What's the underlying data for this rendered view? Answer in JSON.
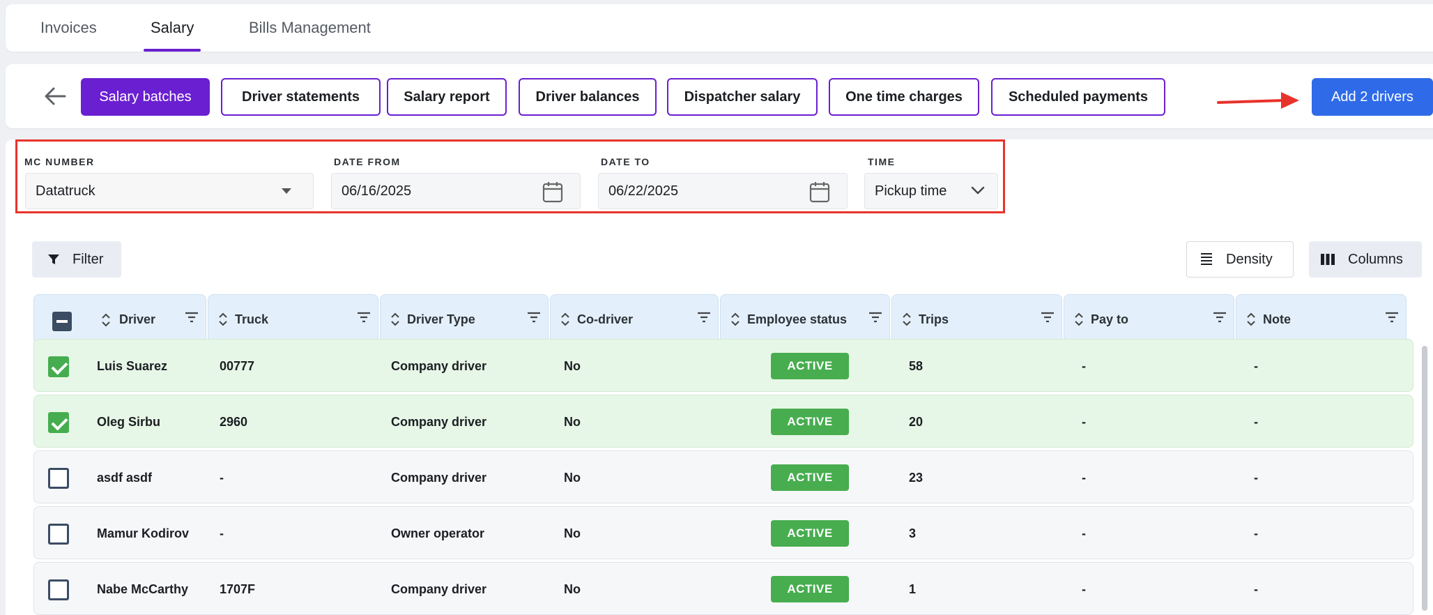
{
  "top_tabs": [
    {
      "label": "Invoices",
      "active": false
    },
    {
      "label": "Salary",
      "active": true
    },
    {
      "label": "Bills Management",
      "active": false
    }
  ],
  "subnav": {
    "back_icon": "arrow-left-icon",
    "buttons": [
      {
        "label": "Salary batches",
        "active": true
      },
      {
        "label": "Driver statements",
        "active": false
      },
      {
        "label": "Salary report",
        "active": false
      },
      {
        "label": "Driver balances",
        "active": false
      },
      {
        "label": "Dispatcher salary",
        "active": false
      },
      {
        "label": "One time charges",
        "active": false
      },
      {
        "label": "Scheduled payments",
        "active": false
      }
    ],
    "add_button": "Add 2 drivers"
  },
  "filters": {
    "mc_number": {
      "label": "MC NUMBER",
      "value": "Datatruck"
    },
    "date_from": {
      "label": "DATE FROM",
      "value": "06/16/2025"
    },
    "date_to": {
      "label": "DATE TO",
      "value": "06/22/2025"
    },
    "time": {
      "label": "TIME",
      "value": "Pickup time"
    }
  },
  "toolbar": {
    "filter": "Filter",
    "density": "Density",
    "columns": "Columns"
  },
  "table": {
    "columns": [
      "Driver",
      "Truck",
      "Driver Type",
      "Co-driver",
      "Employee status",
      "Trips",
      "Pay to",
      "Note"
    ],
    "rows": [
      {
        "checked": true,
        "driver": "Luis Suarez",
        "truck": "00777",
        "driver_type": "Company driver",
        "co_driver": "No",
        "status": "ACTIVE",
        "trips": "58",
        "pay_to": "-",
        "note": "-"
      },
      {
        "checked": true,
        "driver": "Oleg Sirbu",
        "truck": "2960",
        "driver_type": "Company driver",
        "co_driver": "No",
        "status": "ACTIVE",
        "trips": "20",
        "pay_to": "-",
        "note": "-"
      },
      {
        "checked": false,
        "driver": "asdf asdf",
        "truck": "-",
        "driver_type": "Company driver",
        "co_driver": "No",
        "status": "ACTIVE",
        "trips": "23",
        "pay_to": "-",
        "note": "-"
      },
      {
        "checked": false,
        "driver": "Mamur Kodirov",
        "truck": "-",
        "driver_type": "Owner operator",
        "co_driver": "No",
        "status": "ACTIVE",
        "trips": "3",
        "pay_to": "-",
        "note": "-"
      },
      {
        "checked": false,
        "driver": "Nabe McCarthy",
        "truck": "1707F",
        "driver_type": "Company driver",
        "co_driver": "No",
        "status": "ACTIVE",
        "trips": "1",
        "pay_to": "-",
        "note": "-"
      }
    ]
  },
  "colors": {
    "accent": "#6a1fd0",
    "primary_button": "#2f6be8",
    "active_badge": "#47ad4f",
    "annotation": "#e8332c"
  }
}
